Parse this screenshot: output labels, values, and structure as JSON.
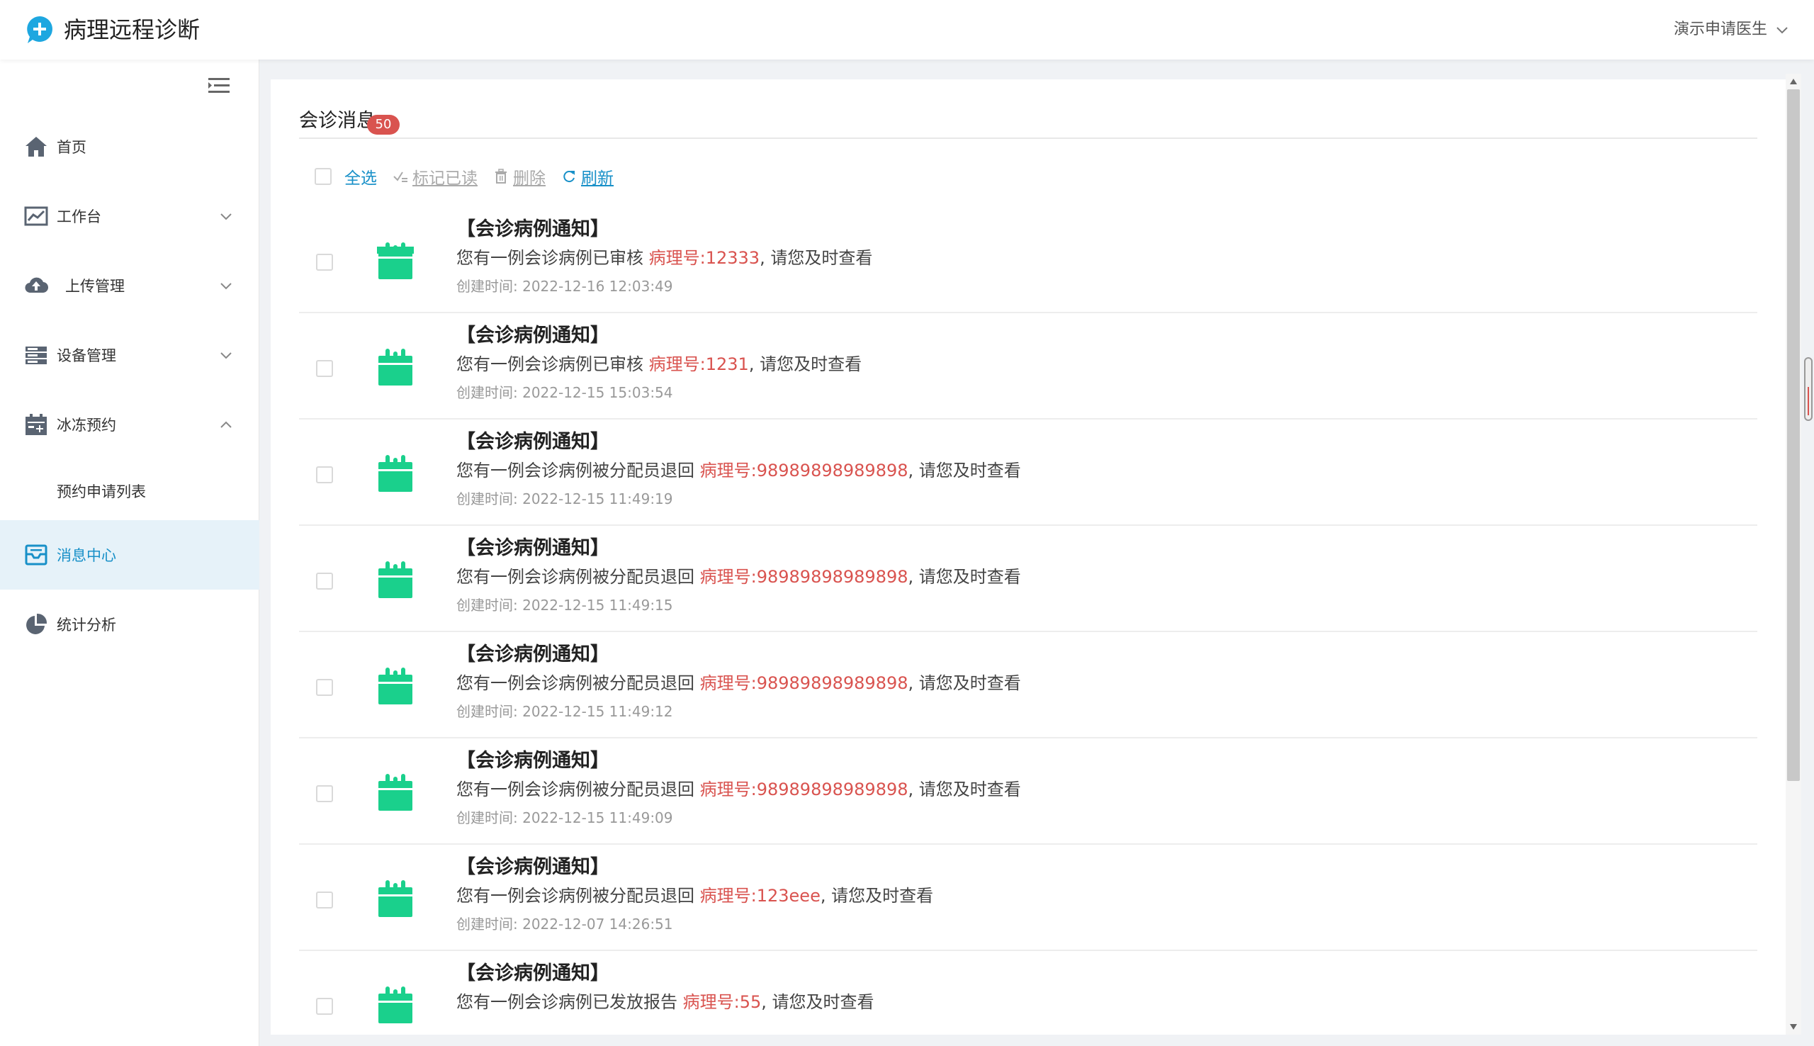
{
  "header": {
    "app_title": "病理远程诊断",
    "user_name": "演示申请医生",
    "logo_icon": "plus-bubble-icon",
    "brand_color": "#1ea7e0"
  },
  "sidebar": {
    "items": [
      {
        "label": "首页",
        "icon": "home-icon",
        "has_arrow": false
      },
      {
        "label": "工作台",
        "icon": "chart-line-icon",
        "has_arrow": true,
        "expanded": false
      },
      {
        "label": "上传管理",
        "icon": "cloud-upload-icon",
        "has_arrow": true,
        "expanded": false
      },
      {
        "label": "设备管理",
        "icon": "device-list-icon",
        "has_arrow": true,
        "expanded": false
      },
      {
        "label": "冰冻预约",
        "icon": "calendar-plus-icon",
        "has_arrow": true,
        "expanded": true
      },
      {
        "label": "预约申请列表",
        "sub": true
      },
      {
        "label": "消息中心",
        "icon": "message-box-icon",
        "active": true
      },
      {
        "label": "统计分析",
        "icon": "pie-chart-icon",
        "has_arrow": false
      }
    ],
    "active_color": "#1890c8",
    "active_bg": "#e6f2f9"
  },
  "main": {
    "title": "会诊消息",
    "unread_count": "50",
    "toolbar": {
      "select_all": "全选",
      "mark_read": "标记已读",
      "delete": "删除",
      "refresh": "刷新"
    },
    "messages": [
      {
        "title": "【会诊病例通知】",
        "prefix": "您有一例会诊病例已审核 ",
        "case": "病理号:12333",
        "suffix": ", 请您及时查看",
        "time": "创建时间: 2022-12-16 12:03:49"
      },
      {
        "title": "【会诊病例通知】",
        "prefix": "您有一例会诊病例已审核 ",
        "case": "病理号:1231",
        "suffix": ", 请您及时查看",
        "time": "创建时间: 2022-12-15 15:03:54"
      },
      {
        "title": "【会诊病例通知】",
        "prefix": "您有一例会诊病例被分配员退回 ",
        "case": "病理号:98989898989898",
        "suffix": ", 请您及时查看",
        "time": "创建时间: 2022-12-15 11:49:19"
      },
      {
        "title": "【会诊病例通知】",
        "prefix": "您有一例会诊病例被分配员退回 ",
        "case": "病理号:98989898989898",
        "suffix": ", 请您及时查看",
        "time": "创建时间: 2022-12-15 11:49:15"
      },
      {
        "title": "【会诊病例通知】",
        "prefix": "您有一例会诊病例被分配员退回 ",
        "case": "病理号:98989898989898",
        "suffix": ", 请您及时查看",
        "time": "创建时间: 2022-12-15 11:49:12"
      },
      {
        "title": "【会诊病例通知】",
        "prefix": "您有一例会诊病例被分配员退回 ",
        "case": "病理号:98989898989898",
        "suffix": ", 请您及时查看",
        "time": "创建时间: 2022-12-15 11:49:09"
      },
      {
        "title": "【会诊病例通知】",
        "prefix": "您有一例会诊病例被分配员退回 ",
        "case": "病理号:123eee",
        "suffix": ", 请您及时查看",
        "time": "创建时间: 2022-12-07 14:26:51"
      },
      {
        "title": "【会诊病例通知】",
        "prefix": "您有一例会诊病例已发放报告 ",
        "case": "病理号:55",
        "suffix": ", 请您及时查看",
        "time": ""
      }
    ],
    "highlight_color": "#d9534f",
    "message_icon": "calendar-icon",
    "message_icon_color": "#1ad08c"
  }
}
